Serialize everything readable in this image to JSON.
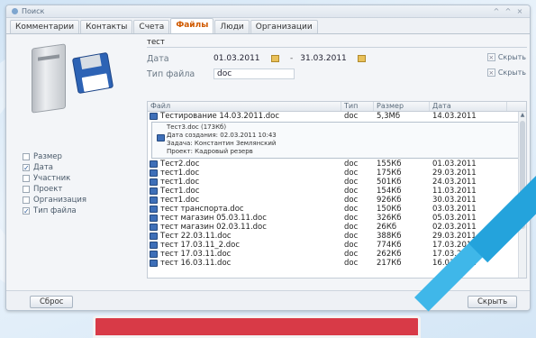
{
  "window": {
    "title": "Поиск",
    "controls": [
      "^",
      "^",
      "×"
    ]
  },
  "tabs": [
    {
      "label": "Комментарии",
      "active": false
    },
    {
      "label": "Контакты",
      "active": false
    },
    {
      "label": "Счета",
      "active": false
    },
    {
      "label": "Файлы",
      "active": true
    },
    {
      "label": "Люди",
      "active": false
    },
    {
      "label": "Организации",
      "active": false
    }
  ],
  "search": {
    "query": "тест"
  },
  "filters": {
    "date_label": "Дата",
    "date_from": "01.03.2011",
    "date_to": "31.03.2011",
    "date_separator": "-",
    "type_label": "Тип файла",
    "type_value": "doc",
    "hide_label_1": "Скрыть",
    "hide_label_2": "Скрыть"
  },
  "criteria": [
    {
      "label": "Размер",
      "checked": false
    },
    {
      "label": "Дата",
      "checked": true
    },
    {
      "label": "Участник",
      "checked": false
    },
    {
      "label": "Проект",
      "checked": false
    },
    {
      "label": "Организация",
      "checked": false
    },
    {
      "label": "Тип файла",
      "checked": true
    }
  ],
  "table": {
    "headers": {
      "file": "Файл",
      "type": "Тип",
      "size": "Размер",
      "date": "Дата"
    },
    "first_row": {
      "file": "Тестирование 14.03.2011.doc",
      "type": "doc",
      "size": "5,3Мб",
      "date": "14.03.2011"
    },
    "tooltip": {
      "line1": "Тест3.doc (173Кб)",
      "line2": "Дата создания: 02.03.2011 10:43",
      "line3": "Задача: Константин Землянский",
      "line4": "Проект: Кадровый резерв"
    },
    "rows": [
      {
        "file": "Тест2.doc",
        "type": "doc",
        "size": "155Кб",
        "date": "01.03.2011"
      },
      {
        "file": "тест1.doc",
        "type": "doc",
        "size": "175Кб",
        "date": "29.03.2011"
      },
      {
        "file": "тест1.doc",
        "type": "doc",
        "size": "501Кб",
        "date": "24.03.2011"
      },
      {
        "file": "Тест1.doc",
        "type": "doc",
        "size": "154Кб",
        "date": "11.03.2011"
      },
      {
        "file": "тест1.doc",
        "type": "doc",
        "size": "926Кб",
        "date": "30.03.2011"
      },
      {
        "file": "тест транспорта.doc",
        "type": "doc",
        "size": "150Кб",
        "date": "03.03.2011"
      },
      {
        "file": "тест магазин 05.03.11.doc",
        "type": "doc",
        "size": "326Кб",
        "date": "05.03.2011"
      },
      {
        "file": "тест магазин 02.03.11.doc",
        "type": "doc",
        "size": "26Кб",
        "date": "02.03.2011"
      },
      {
        "file": "Тест 22.03.11.doc",
        "type": "doc",
        "size": "388Кб",
        "date": "29.03.2011"
      },
      {
        "file": "тест 17.03.11_2.doc",
        "type": "doc",
        "size": "774Кб",
        "date": "17.03.2011"
      },
      {
        "file": "тест 17.03.11.doc",
        "type": "doc",
        "size": "262Кб",
        "date": "17.03.2011"
      },
      {
        "file": "тест 16.03.11.doc",
        "type": "doc",
        "size": "217Кб",
        "date": "16.03.2011"
      }
    ]
  },
  "buttons": {
    "reset": "Сброс",
    "right": "Скрыть"
  }
}
